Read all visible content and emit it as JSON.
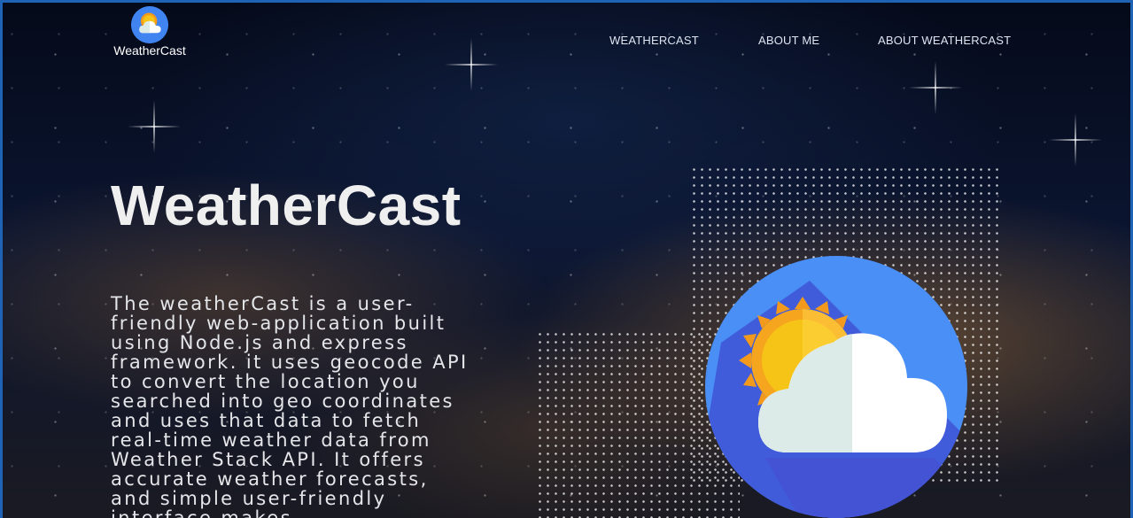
{
  "header": {
    "logo_text": "WeatherCast",
    "logo_icon": "weather-sun-cloud-icon"
  },
  "nav": {
    "items": [
      {
        "label": "WEATHERCAST"
      },
      {
        "label": "ABOUT ME"
      },
      {
        "label": "ABOUT WEATHERCAST"
      }
    ]
  },
  "hero": {
    "title": "WeatherCast",
    "description": "The weatherCast is a user-friendly web-application built using Node.js and express framework. it uses geocode API to convert the location you searched into geo coordinates and uses that data to fetch real-time weather data from Weather Stack API. It offers accurate weather forecasts, and simple user-friendly interface makes",
    "illustration_icon": "weather-sun-cloud-icon"
  },
  "colors": {
    "accent_blue": "#3f84f0",
    "sun_yellow": "#f6c417",
    "sun_orange": "#f39a1c",
    "cloud_white": "#ffffff",
    "cloud_shade": "#dcebe8",
    "frame_border": "#1f63b6"
  }
}
